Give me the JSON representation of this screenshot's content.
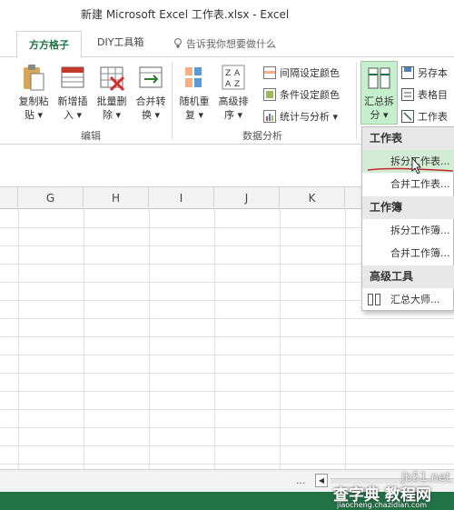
{
  "window": {
    "title": "新建 Microsoft Excel 工作表.xlsx - Excel"
  },
  "tabs": {
    "active": "方方格子",
    "diy": "DIY工具箱"
  },
  "tellme": {
    "text": "告诉我你想要做什么"
  },
  "ribbon": {
    "edit_group": {
      "label": "编辑",
      "buttons": [
        {
          "line1": "复制粘",
          "line2": "贴 ▾"
        },
        {
          "line1": "新增插",
          "line2": "入 ▾"
        },
        {
          "line1": "批量删",
          "line2": "除 ▾"
        },
        {
          "line1": "合并转",
          "line2": "换 ▾"
        }
      ]
    },
    "data_group": {
      "label": "数据分析",
      "buttons": [
        {
          "line1": "随机重",
          "line2": "复 ▾"
        },
        {
          "line1": "高级排",
          "line2": "序 ▾"
        }
      ],
      "small": [
        "间隔设定颜色",
        "条件设定颜色",
        "统计与分析 ▾"
      ]
    },
    "huizong": {
      "line1": "汇总拆",
      "line2": "分 ▾"
    },
    "right_small": [
      "另存本",
      "表格目",
      "工作表"
    ]
  },
  "sheet": {
    "columns": [
      "G",
      "H",
      "I",
      "J",
      "K"
    ]
  },
  "dropdown": {
    "section1": "工作表",
    "split_sheet": "拆分工作表...",
    "merge_sheet": "合并工作表...",
    "section2": "工作簿",
    "split_book": "拆分工作簿...",
    "merge_book": "合并工作簿...",
    "section3": "高级工具",
    "master": "汇总大师..."
  },
  "status": {
    "dots": "..."
  },
  "watermark": {
    "url": "jb51.net",
    "main": "查字典 教程网",
    "sub": "jiaocheng.chazidian.com"
  },
  "colors": {
    "excel_green": "#217346",
    "highlight": "#c6efce"
  }
}
